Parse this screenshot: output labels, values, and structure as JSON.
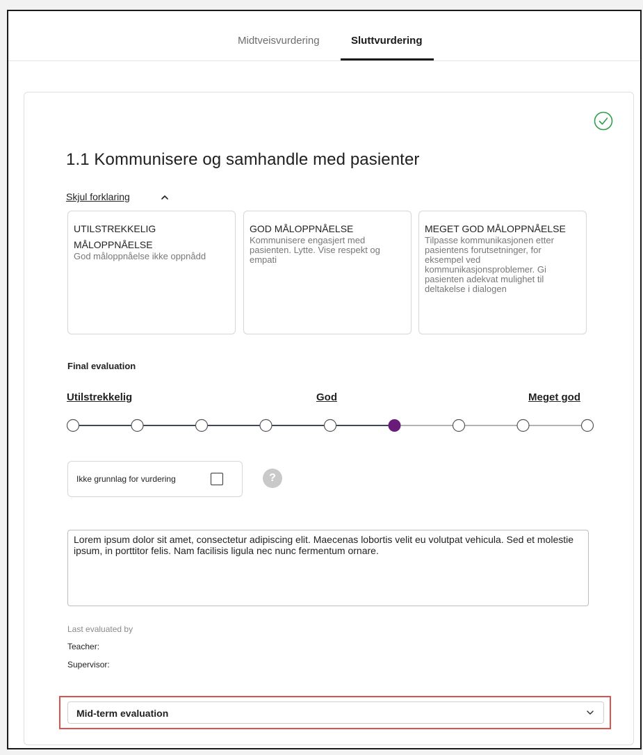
{
  "tabs": [
    {
      "label": "Midtveisvurdering",
      "active": false
    },
    {
      "label": "Sluttvurdering",
      "active": true
    }
  ],
  "section": {
    "title": "1.1 Kommunisere og samhandle med pasienter",
    "toggle_label": "Skjul forklaring",
    "status_icon": "check-circle-icon",
    "levels": [
      {
        "title": "UTILSTREKKELIG MÅLOPPNÅELSE",
        "description": "God måloppnåelse ikke oppnådd"
      },
      {
        "title": "GOD MÅLOPPNÅELSE",
        "description": "Kommunisere engasjert med pasienten. Lytte. Vise respekt og empati"
      },
      {
        "title": "MEGET GOD MÅLOPPNÅELSE",
        "description": "Tilpasse kommunikasjonen etter pasientens forutsetninger, for eksempel ved kommunikasjonsproblemer. Gi pasienten adekvat mulighet til deltakelse i dialogen"
      }
    ]
  },
  "evaluation": {
    "label": "Final evaluation",
    "scale_labels": [
      "Utilstrekkelig",
      "God",
      "Meget god"
    ],
    "steps": 9,
    "selected_step": 6,
    "no_basis_label": "Ikke grunnlag for vurdering",
    "no_basis_checked": false,
    "comment": "Lorem ipsum dolor sit amet, consectetur adipiscing elit. Maecenas lobortis velit eu volutpat vehicula. Sed et molestie ipsum, in porttitor felis. Nam facilisis ligula nec nunc fermentum ornare."
  },
  "last_evaluated": {
    "label": "Last evaluated by",
    "teacher_label": "Teacher:",
    "supervisor_label": "Supervisor:"
  },
  "dropdown": {
    "selected": "Mid-term evaluation"
  },
  "colors": {
    "accent": "#6a1b7a",
    "track_active": "#3b4a5a",
    "success": "#2e9e4a",
    "highlight": "#d9534f"
  }
}
